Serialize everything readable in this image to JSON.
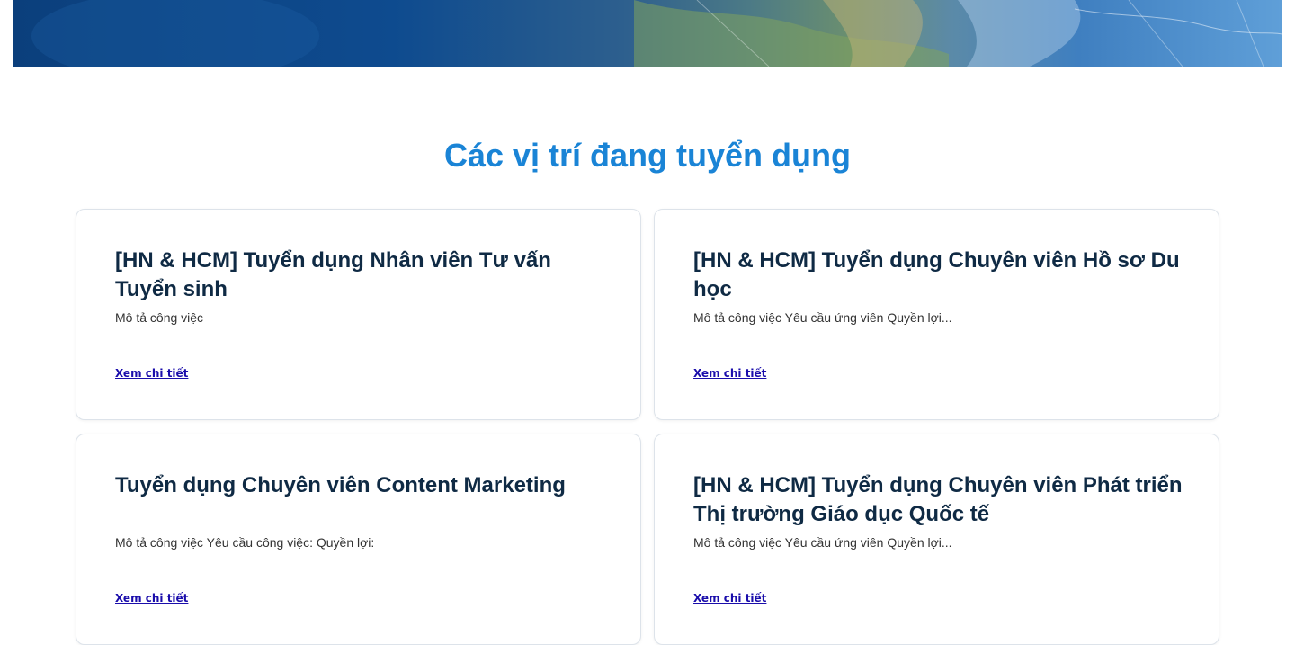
{
  "section": {
    "title": "Các vị trí đang tuyển dụng"
  },
  "jobs": [
    {
      "title": "[HN & HCM] Tuyển dụng Nhân viên Tư vấn Tuyển sinh",
      "description": "Mô tả công việc",
      "link_label": "Xem chi tiết"
    },
    {
      "title": "[HN & HCM] Tuyển dụng Chuyên viên Hồ sơ Du học",
      "description": "Mô tả công việc Yêu cầu ứng viên Quyền lợi...",
      "link_label": "Xem chi tiết"
    },
    {
      "title": "Tuyển dụng Chuyên viên Content Marketing",
      "description": "Mô tả công việc Yêu cầu công việc: Quyền lợi:",
      "link_label": "Xem chi tiết"
    },
    {
      "title": "[HN & HCM] Tuyển dụng Chuyên viên Phát triển Thị trường Giáo dục Quốc tế",
      "description": "Mô tả công việc Yêu cầu ứng viên Quyền lợi...",
      "link_label": "Xem chi tiết"
    }
  ]
}
